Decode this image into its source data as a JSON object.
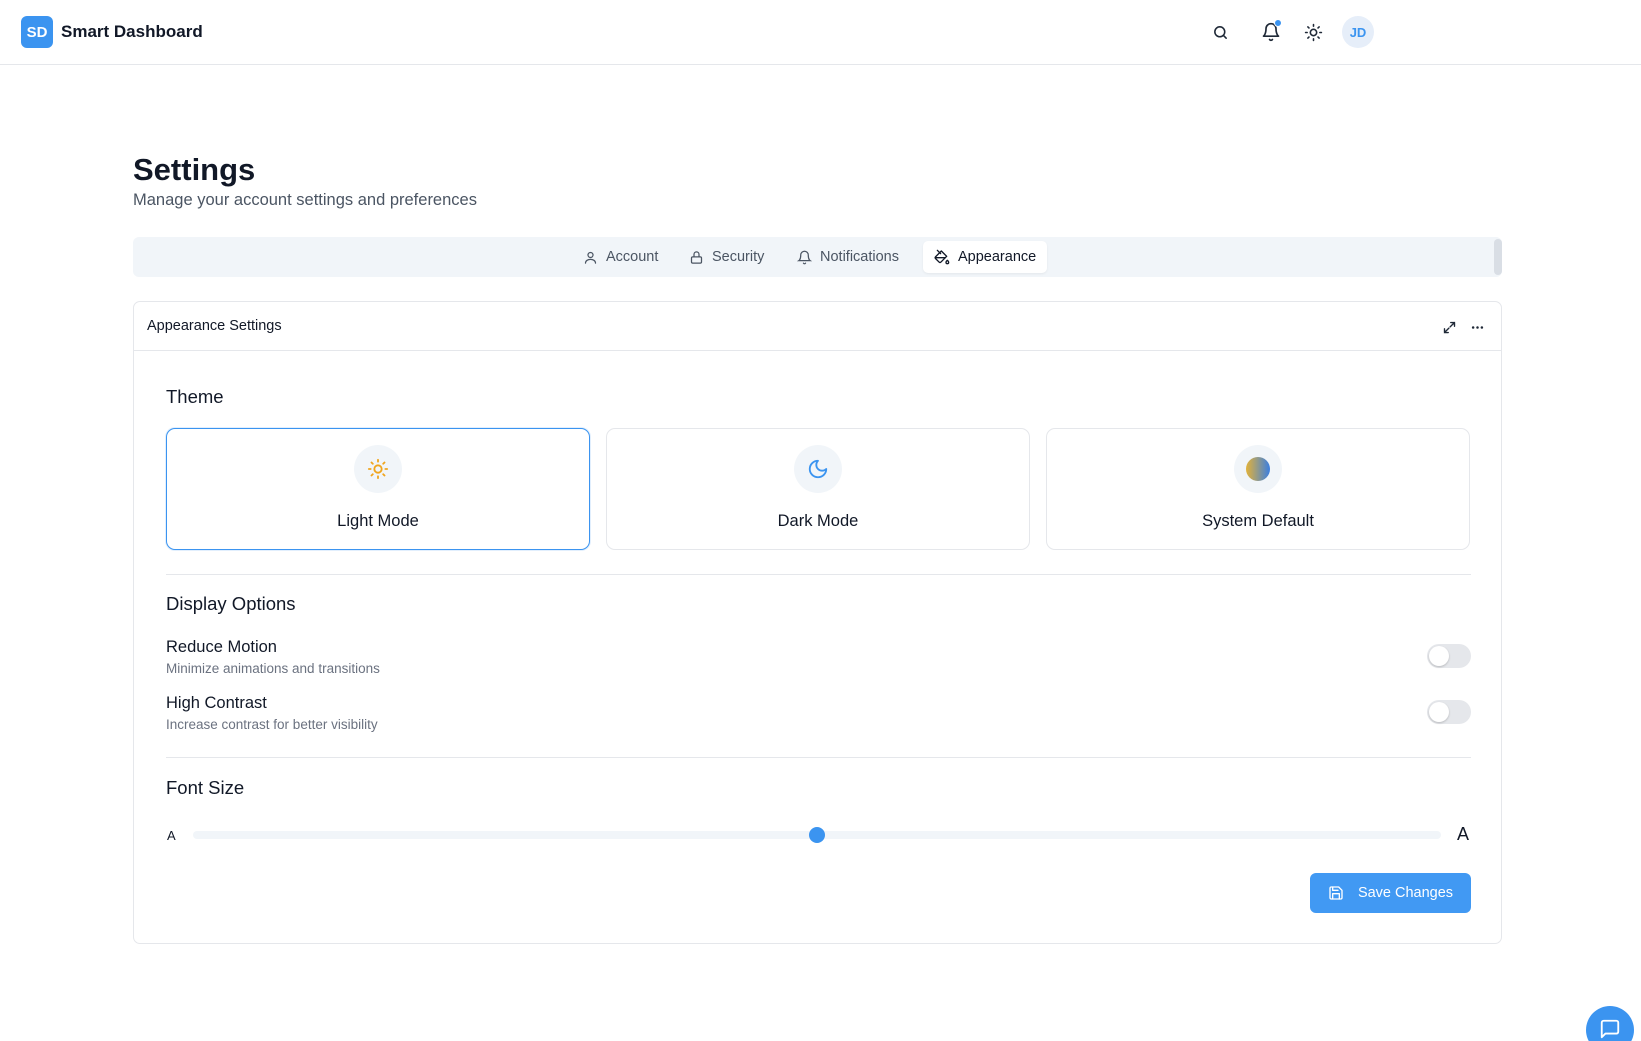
{
  "app": {
    "logo_text": "SD",
    "title": "Smart Dashboard"
  },
  "header": {
    "icons": [
      "search-icon",
      "bell-icon",
      "sun-icon"
    ],
    "has_notification": true,
    "avatar_initials": "JD"
  },
  "page": {
    "title": "Settings",
    "subtitle": "Manage your account settings and preferences"
  },
  "tabs": [
    {
      "label": "Account",
      "icon": "user-icon",
      "active": false
    },
    {
      "label": "Security",
      "icon": "lock-icon",
      "active": false
    },
    {
      "label": "Notifications",
      "icon": "bell-icon",
      "active": false
    },
    {
      "label": "Appearance",
      "icon": "paint-bucket-icon",
      "active": true
    }
  ],
  "panel": {
    "title": "Appearance Settings",
    "header_icons": [
      "expand-icon",
      "more-icon"
    ],
    "theme": {
      "title": "Theme",
      "options": [
        {
          "label": "Light Mode",
          "icon": "sun-icon",
          "selected": true
        },
        {
          "label": "Dark Mode",
          "icon": "moon-icon",
          "selected": false
        },
        {
          "label": "System Default",
          "icon": "half-circle-icon",
          "selected": false
        }
      ]
    },
    "display": {
      "title": "Display Options",
      "options": [
        {
          "label": "Reduce Motion",
          "description": "Minimize animations and transitions",
          "enabled": false
        },
        {
          "label": "High Contrast",
          "description": "Increase contrast for better visibility",
          "enabled": false
        }
      ]
    },
    "font_size": {
      "title": "Font Size",
      "small_label": "A",
      "large_label": "A",
      "value_fraction": 0.5
    },
    "save_label": "Save Changes"
  },
  "colors": {
    "accent": "#3b94f0",
    "sun": "#f0a51e",
    "border": "#e5e7eb",
    "muted": "#f1f5f9"
  }
}
